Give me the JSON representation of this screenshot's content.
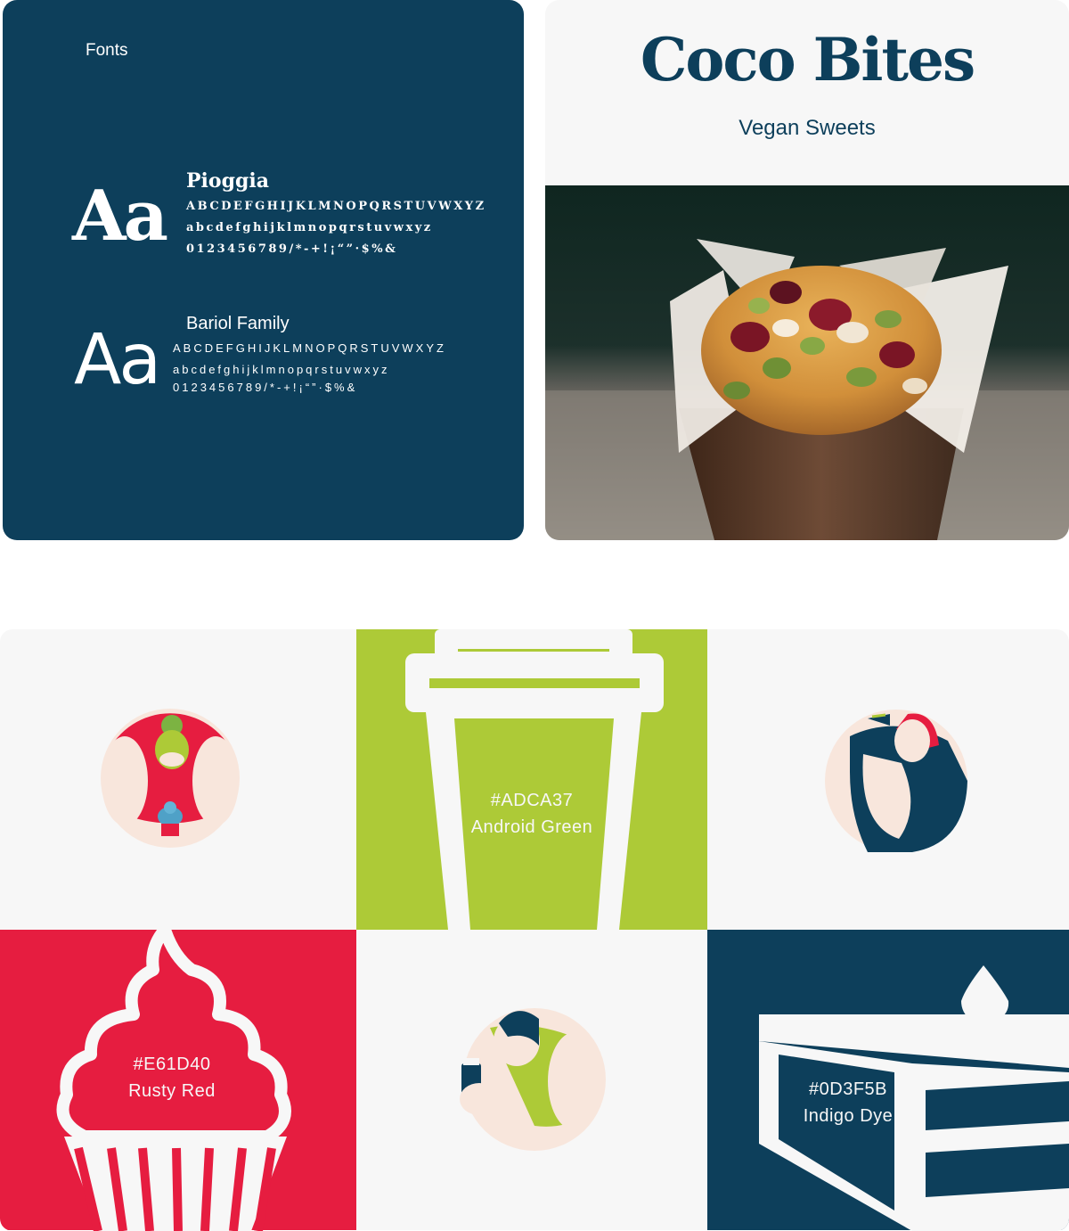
{
  "fonts_card": {
    "heading": "Fonts",
    "serif": {
      "sample": "Aa",
      "name": "Pioggia",
      "uppercase": "ABCDEFGHIJKLMNOPQRSTUVWXYZ",
      "lowercase": "abcdefghijklmnopqrstuvwxyz",
      "digits": "0123456789/*-+!¡“”·$%&"
    },
    "sans": {
      "sample": "Aa",
      "name": "Bariol Family",
      "uppercase": "ABCDEFGHIJKLMNOPQRSTUVWXYZ",
      "lowercase": "abcdefghijklmnopqrstuvwxyz",
      "digits": "0123456789/*-+!¡“”·$%&"
    }
  },
  "brand": {
    "name": "Coco Bites",
    "tagline": "Vegan Sweets"
  },
  "palette": [
    {
      "hex": "#ADCA37",
      "name": "Android Green",
      "icon": "coffee-cup-icon"
    },
    {
      "hex": "#E61D40",
      "name": "Rusty Red",
      "icon": "cupcake-icon"
    },
    {
      "hex": "#0D3F5B",
      "name": "Indigo Dye",
      "icon": "cake-slice-icon"
    }
  ],
  "illustrations": [
    {
      "icon": "person-holding-cupcake-illustration"
    },
    {
      "icon": "person-eating-cake-illustration"
    },
    {
      "icon": "person-holding-coffee-illustration"
    }
  ],
  "colors": {
    "indigo": "#0D3F5B",
    "green": "#ADCA37",
    "red": "#E61D40",
    "light_bg": "#F7F7F7",
    "skin": "#F8E6DC"
  }
}
